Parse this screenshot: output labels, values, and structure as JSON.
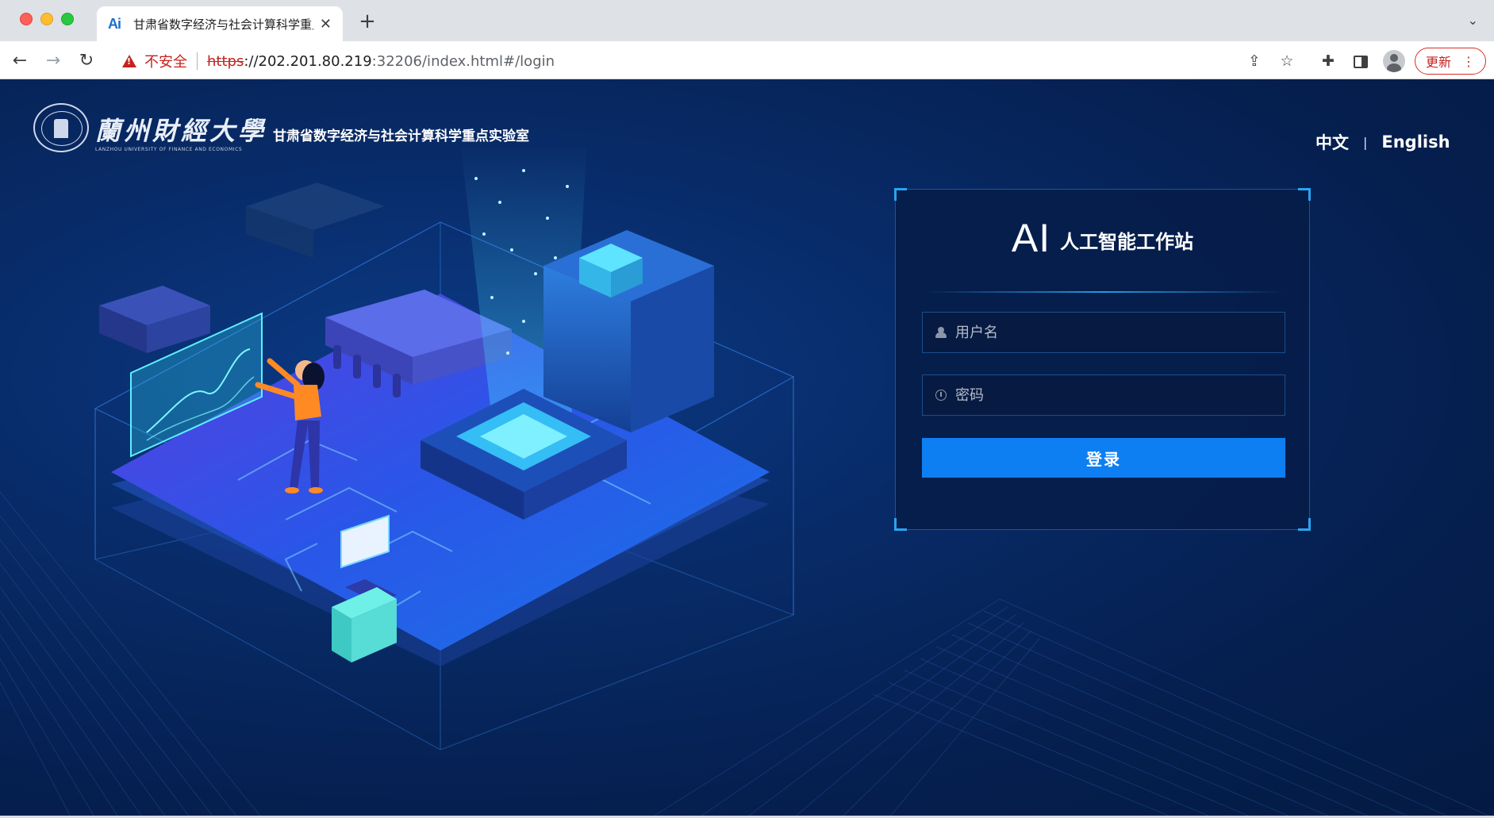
{
  "browser": {
    "tab_title": "甘肃省数字经济与社会计算科学重点实验室",
    "tab_favicon_text": "Ai",
    "new_tab_label": "+",
    "url_scheme": "https",
    "url_host": "://202.201.80.219",
    "url_path": ":32206/index.html#/login",
    "security_label": "不安全",
    "update_label": "更新"
  },
  "brand": {
    "university_name": "蘭州財經大學",
    "university_name_en": "LANZHOU UNIVERSITY OF FINANCE AND ECONOMICS",
    "lab_name": "甘肃省数字经济与社会计算科学重点实验室"
  },
  "language": {
    "chinese": "中文",
    "separator": "|",
    "english": "English"
  },
  "login": {
    "logo_mark": "AI",
    "title": "人工智能工作站",
    "username_placeholder": "用户名",
    "password_placeholder": "密码",
    "submit_label": "登录"
  },
  "colors": {
    "page_background": "#082b68",
    "accent_blue": "#0d7ff3",
    "card_border": "#2aa4f0",
    "insecure_red": "#c5221f"
  }
}
